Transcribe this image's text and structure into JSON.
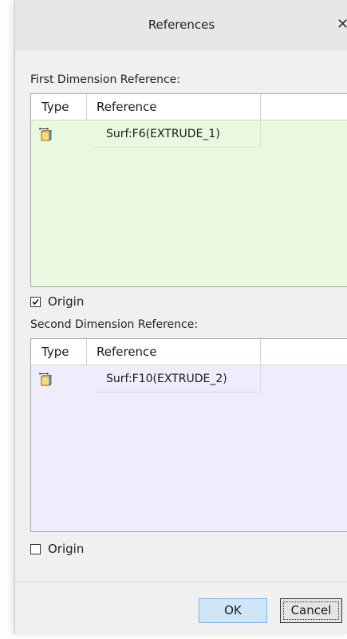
{
  "window": {
    "title": "References"
  },
  "first_reference": {
    "label": "First Dimension Reference:",
    "columns": [
      "Type",
      "Reference"
    ],
    "rows": [
      {
        "icon": "surface-reference-icon",
        "reference": "Surf:F6(EXTRUDE_1)"
      }
    ],
    "background": "#e9f9e0",
    "origin": {
      "label": "Origin",
      "checked": true
    }
  },
  "second_reference": {
    "label": "Second Dimension Reference:",
    "columns": [
      "Type",
      "Reference"
    ],
    "rows": [
      {
        "icon": "surface-reference-icon",
        "reference": "Surf:F10(EXTRUDE_2)"
      }
    ],
    "background": "#efecfb",
    "origin": {
      "label": "Origin",
      "checked": false
    }
  },
  "buttons": {
    "ok": "OK",
    "cancel": "Cancel"
  },
  "colors": {
    "ok_button": "#cfe6f7",
    "ok_border": "#7eb4ea"
  }
}
